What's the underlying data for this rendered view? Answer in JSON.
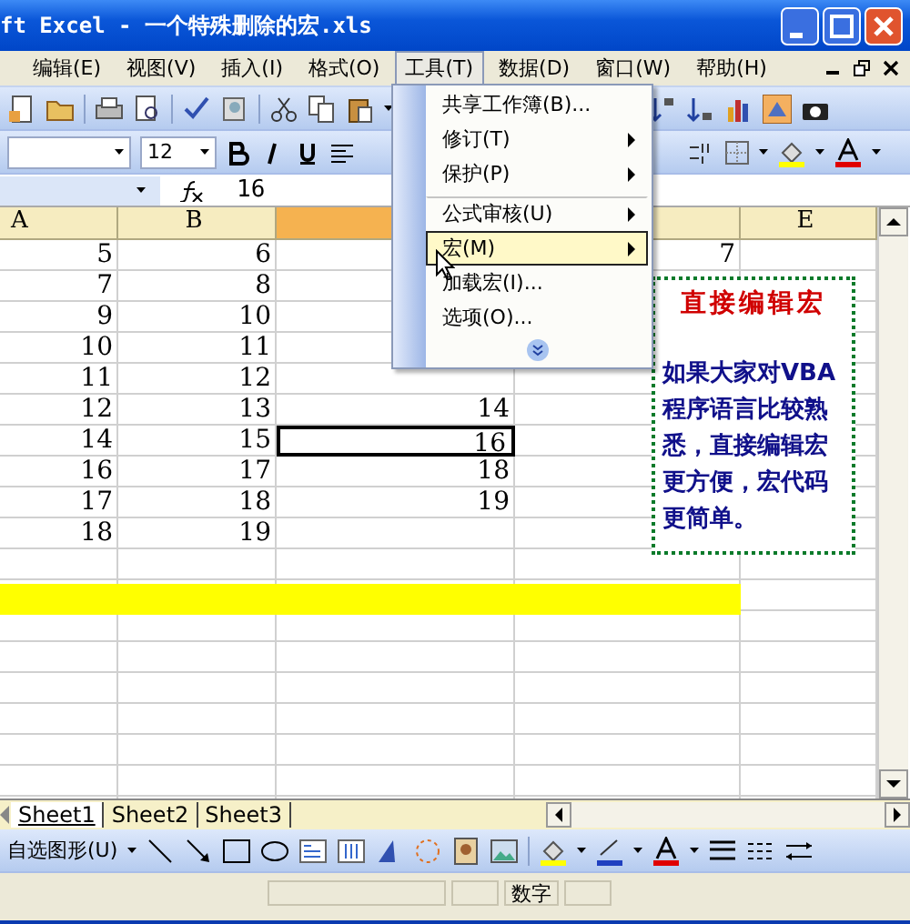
{
  "window": {
    "title": "ft Excel - 一个特殊删除的宏.xls"
  },
  "menu_bar": [
    {
      "label": "编辑(E)",
      "selected": false
    },
    {
      "label": "视图(V)",
      "selected": false
    },
    {
      "label": "插入(I)",
      "selected": false
    },
    {
      "label": "格式(O)",
      "selected": false
    },
    {
      "label": "工具(T)",
      "selected": true
    },
    {
      "label": "数据(D)",
      "selected": false
    },
    {
      "label": "窗口(W)",
      "selected": false
    },
    {
      "label": "帮助(H)",
      "selected": false
    }
  ],
  "formatting_toolbar": {
    "font_size": "12"
  },
  "formula_bar": {
    "value": "16"
  },
  "columns": [
    {
      "label": "A",
      "selected": false
    },
    {
      "label": "B",
      "selected": false
    },
    {
      "selected": true
    },
    {
      "selected": false
    },
    {
      "label": "E",
      "selected": false
    }
  ],
  "rows": [
    {
      "highlighted": false,
      "col_a": {
        "text": "5",
        "selected": false
      },
      "col_b": {
        "text": "6",
        "selected": false
      },
      "col_d": {
        "text": "7",
        "selected": false
      }
    },
    {
      "highlighted": false,
      "col_a": {
        "text": "7",
        "selected": false
      },
      "col_b": {
        "text": "8",
        "selected": false
      }
    },
    {
      "highlighted": false,
      "col_a": {
        "text": "9",
        "selected": false
      },
      "col_b": {
        "text": "10",
        "selected": false
      }
    },
    {
      "highlighted": false,
      "col_a": {
        "text": "10",
        "selected": false
      },
      "col_b": {
        "text": "11",
        "selected": false
      }
    },
    {
      "highlighted": false,
      "col_a": {
        "text": "11",
        "selected": false
      },
      "col_b": {
        "text": "12",
        "selected": false
      }
    },
    {
      "highlighted": false,
      "col_a": {
        "text": "12",
        "selected": false
      },
      "col_b": {
        "text": "13",
        "selected": false
      },
      "col_c": {
        "text": "14",
        "selected": false
      }
    },
    {
      "highlighted": false,
      "col_a": {
        "text": "14",
        "selected": false
      },
      "col_b": {
        "text": "15",
        "selected": false
      },
      "col_c": {
        "text": "16",
        "selected": true
      }
    },
    {
      "highlighted": false,
      "col_a": {
        "text": "16",
        "selected": false
      },
      "col_b": {
        "text": "17",
        "selected": false
      },
      "col_c": {
        "text": "18",
        "selected": false
      }
    },
    {
      "highlighted": false,
      "col_a": {
        "text": "17",
        "selected": false
      },
      "col_b": {
        "text": "18",
        "selected": false
      },
      "col_c": {
        "text": "19",
        "selected": false
      }
    },
    {
      "highlighted": false,
      "col_a": {
        "text": "18",
        "selected": false
      },
      "col_b": {
        "text": "19",
        "selected": false
      }
    },
    {
      "highlighted": false
    },
    {
      "highlighted": true
    },
    {
      "highlighted": false
    },
    {
      "highlighted": false
    },
    {
      "highlighted": false
    },
    {
      "highlighted": false
    },
    {
      "highlighted": false
    },
    {
      "highlighted": false
    }
  ],
  "text_box": {
    "title": "直接编辑宏",
    "body": "如果大家对VBA程序语言比较熟悉，直接编辑宏更方便，宏代码更简单。"
  },
  "tools_menu": {
    "items": [
      {
        "label": "共享工作簿(B)...",
        "submenu": false,
        "separator_before": false,
        "selected": false
      },
      {
        "label": "修订(T)",
        "submenu": true,
        "separator_before": false,
        "selected": false
      },
      {
        "label": "保护(P)",
        "submenu": true,
        "separator_before": false,
        "selected": false
      },
      {
        "label": "公式审核(U)",
        "submenu": true,
        "separator_before": true,
        "selected": false
      },
      {
        "label": "宏(M)",
        "submenu": true,
        "separator_before": false,
        "selected": true
      },
      {
        "label": "加载宏(I)...",
        "submenu": false,
        "separator_before": false,
        "selected": false
      },
      {
        "label": "选项(O)...",
        "submenu": false,
        "separator_before": false,
        "selected": false
      }
    ],
    "more_button": true
  },
  "sheet_tabs": [
    {
      "label": "Sheet1",
      "selected": true
    },
    {
      "label": "Sheet2",
      "selected": false
    },
    {
      "label": "Sheet3",
      "selected": false
    }
  ],
  "drawing_toolbar": {
    "autoshapes": "自选图形(U)"
  },
  "status_bar": {
    "mode": "数字"
  }
}
